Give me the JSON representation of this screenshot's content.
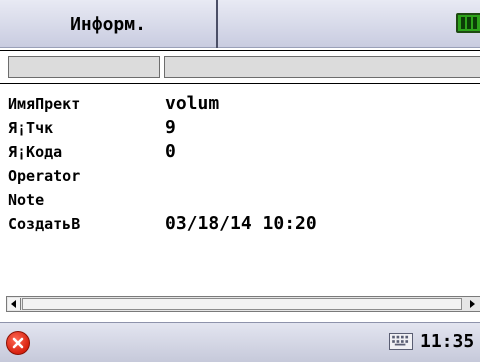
{
  "tabs": {
    "info_label": "Информ."
  },
  "battery": {
    "icon": "battery-icon",
    "color": "#2ea31c"
  },
  "rows": [
    {
      "label": "ИмяПрект",
      "value": "volum"
    },
    {
      "label": "Я¡Тчк",
      "value": "9"
    },
    {
      "label": "Я¡Кода",
      "value": "0"
    },
    {
      "label": "Operator",
      "value": ""
    },
    {
      "label": "Note",
      "value": ""
    },
    {
      "label": "СоздатьВ",
      "value": "03/18/14 10:20"
    }
  ],
  "taskbar": {
    "close_icon": "close-icon",
    "keyboard_icon": "keyboard-icon",
    "time": "11:35"
  },
  "colors": {
    "bar_bg": "#d6d8e8",
    "close_red": "#d8210f"
  }
}
